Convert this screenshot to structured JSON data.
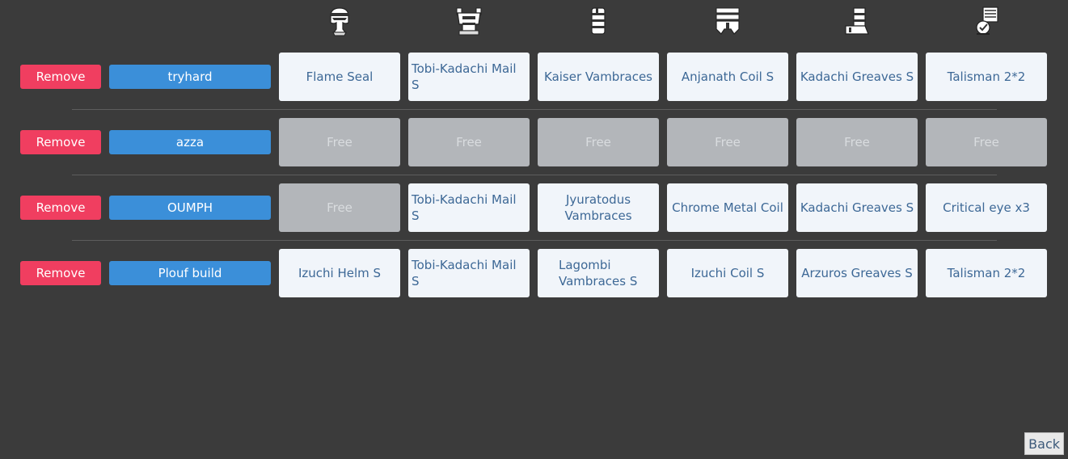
{
  "header": {
    "columns": [
      {
        "icon": "helm-icon"
      },
      {
        "icon": "chest-armor-icon"
      },
      {
        "icon": "gauntlet-icon"
      },
      {
        "icon": "waist-coil-icon"
      },
      {
        "icon": "greaves-icon"
      },
      {
        "icon": "talisman-icon"
      }
    ]
  },
  "builds": [
    {
      "remove_label": "Remove",
      "name": "tryhard",
      "slots": [
        "Flame Seal",
        "Tobi-Kadachi Mail S",
        "Kaiser Vambraces",
        "Anjanath Coil S",
        "Kadachi Greaves S",
        "Talisman 2*2"
      ]
    },
    {
      "remove_label": "Remove",
      "name": "azza",
      "slots": [
        "Free",
        "Free",
        "Free",
        "Free",
        "Free",
        "Free"
      ]
    },
    {
      "remove_label": "Remove",
      "name": "OUMPH",
      "slots": [
        "Free",
        "Tobi-Kadachi Mail S",
        "Jyuratodus Vambraces",
        "Chrome Metal Coil",
        "Kadachi Greaves S",
        "Critical eye x3"
      ]
    },
    {
      "remove_label": "Remove",
      "name": "Plouf build",
      "slots": [
        "Izuchi Helm S",
        "Tobi-Kadachi Mail S",
        "Lagombi Vambraces S",
        "Izuchi Coil S",
        "Arzuros Greaves S",
        "Talisman 2*2"
      ]
    }
  ],
  "free_label": "Free",
  "back_label": "Back",
  "colors": {
    "background": "#3b3b3b",
    "remove": "#f03e60",
    "name": "#3b8fd9",
    "slot": "#f1f5fa",
    "slot_free": "#b3b6ba",
    "slot_text": "#3d6896"
  }
}
